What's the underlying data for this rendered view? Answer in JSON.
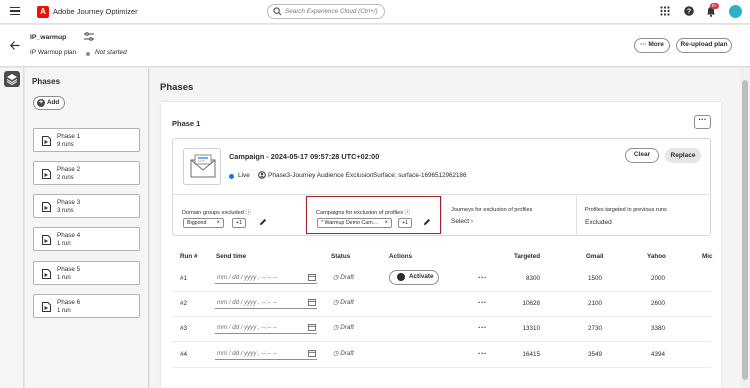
{
  "topbar": {
    "app_name": "Adobe Journey Optimizer",
    "logo_letter": "A",
    "search_placeholder": "Search Experience Cloud (Ctrl+/)",
    "notifications_count": "9+"
  },
  "header": {
    "plan_name": "IP_warmup",
    "plan_type": "IP Warmup plan",
    "status": "Not started",
    "more_label": "More",
    "reupload_label": "Re-upload plan"
  },
  "sidebar": {
    "title": "Phases",
    "add_label": "Add",
    "phases": [
      {
        "name": "Phase 1",
        "runs": "9 runs"
      },
      {
        "name": "Phase 2",
        "runs": "2 runs"
      },
      {
        "name": "Phase 3",
        "runs": "3 runs"
      },
      {
        "name": "Phase 4",
        "runs": "1 run"
      },
      {
        "name": "Phase 5",
        "runs": "1 run"
      },
      {
        "name": "Phase 6",
        "runs": "1 run"
      }
    ]
  },
  "main": {
    "title": "Phases",
    "phase_title": "Phase 1",
    "campaign": {
      "title": "Campaign - 2024-05-17 09:57:28 UTC+02:00",
      "status": "Live",
      "audience": "Phase3-Journey Audience Exclusion",
      "surface": "Surface: surface-1696512962186",
      "clear_label": "Clear",
      "replace_label": "Replace"
    },
    "exclusions": {
      "domain_label": "Domain groups excluded",
      "domain_tag": "Bigpond",
      "domain_more": "+1",
      "campaigns_label": "Campaigns for exclusion of profiles",
      "campaigns_tag": "* Warmup Demo Cam...",
      "campaigns_more": "+1",
      "journeys_label": "Journeys for exclusion of profiles",
      "journeys_value": "Select",
      "profiles_label": "Profiles targeted in previous runs",
      "profiles_value": "Excluded"
    },
    "table": {
      "headers": {
        "run": "Run #",
        "send_time": "Send time",
        "status": "Status",
        "actions": "Actions",
        "targeted": "Targeted",
        "gmail": "Gmail",
        "yahoo": "Yahoo",
        "more": "Mic"
      },
      "date_placeholder": "mm / dd / yyyy ,  --:-- --",
      "activate_label": "Activate",
      "rows": [
        {
          "run": "#1",
          "status": "Draft",
          "targeted": "8300",
          "gmail": "1500",
          "yahoo": "2000"
        },
        {
          "run": "#2",
          "status": "Draft",
          "targeted": "10628",
          "gmail": "2100",
          "yahoo": "2600"
        },
        {
          "run": "#3",
          "status": "Draft",
          "targeted": "13310",
          "gmail": "2730",
          "yahoo": "3380"
        },
        {
          "run": "#4",
          "status": "Draft",
          "targeted": "16415",
          "gmail": "3549",
          "yahoo": "4394"
        }
      ]
    }
  }
}
